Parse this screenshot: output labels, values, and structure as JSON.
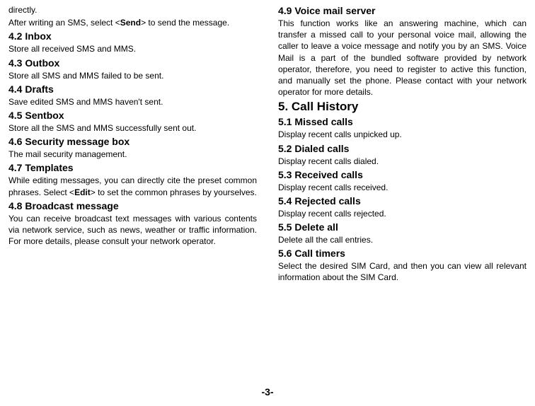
{
  "left": {
    "p_directly": "directly.",
    "p_after_sms_1": "After writing an SMS, select <",
    "p_after_sms_bold": "Send",
    "p_after_sms_2": "> to send the message.",
    "h_4_2": "4.2 Inbox",
    "p_4_2": "Store all received SMS and MMS.",
    "h_4_3": "4.3 Outbox",
    "p_4_3": "Store all SMS and MMS failed to be sent.",
    "h_4_4": "4.4 Drafts",
    "p_4_4": "Save edited SMS and MMS haven't sent.",
    "h_4_5": "4.5 Sentbox",
    "p_4_5": "Store all the SMS and MMS successfully sent out.",
    "h_4_6": "4.6 Security message box",
    "p_4_6": "The mail security management.",
    "h_4_7": "4.7 Templates",
    "p_4_7_1": "While editing messages, you can directly cite the preset common phrases. Select <",
    "p_4_7_bold": "Edit",
    "p_4_7_2": "> to set the common phrases by yourselves.",
    "h_4_8": "4.8 Broadcast message",
    "p_4_8": "You can receive broadcast text messages with various contents via network service, such as news, weather or traffic information. For more details, please consult your network operator."
  },
  "right": {
    "h_4_9": "4.9 Voice mail server",
    "p_4_9": "This function works like an answering machine, which can transfer a missed call to your personal voice mail, allowing the caller to leave a voice message and notify you by an SMS. Voice Mail is a part of the bundled software provided by network operator, therefore, you need to register to active this function, and manually set the phone. Please contact with your network operator for more details.",
    "h_5": "5. Call History",
    "h_5_1": "5.1 Missed calls",
    "p_5_1": "Display recent calls unpicked up.",
    "h_5_2": "5.2 Dialed calls",
    "p_5_2": "Display recent calls dialed.",
    "h_5_3": "5.3 Received calls",
    "p_5_3": "Display recent calls received.",
    "h_5_4": "5.4 Rejected calls",
    "p_5_4": "Display recent calls rejected.",
    "h_5_5": "5.5 Delete all",
    "p_5_5": "Delete all the call entries.",
    "h_5_6": "5.6 Call timers",
    "p_5_6": "Select the desired SIM Card, and then you can view all relevant information about the SIM Card."
  },
  "pagenum": "-3-"
}
